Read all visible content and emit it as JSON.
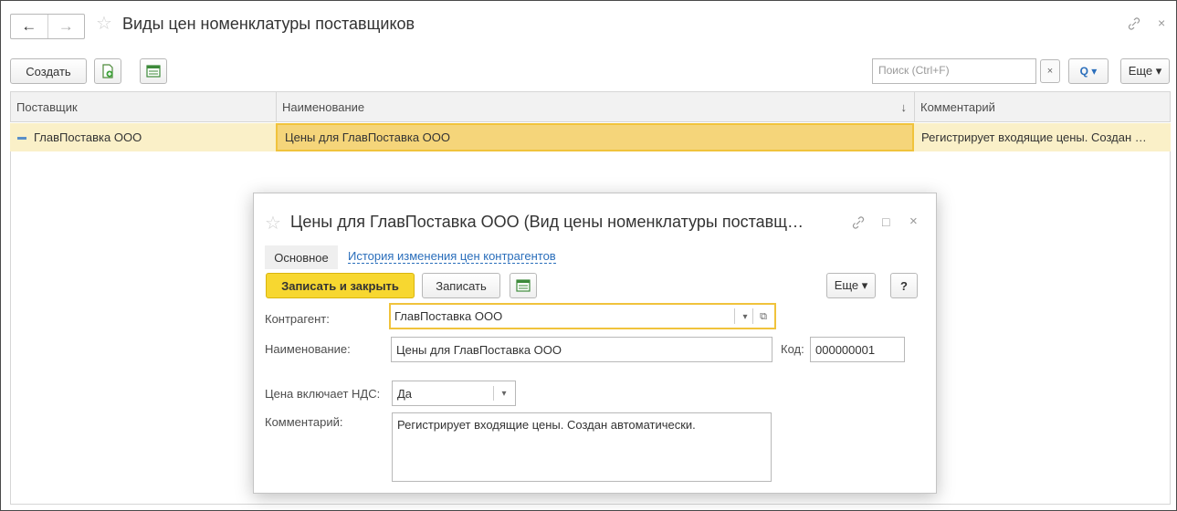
{
  "window": {
    "title": "Виды цен номенклатуры поставщиков",
    "nav_back": "←",
    "nav_forward": "→",
    "star": "☆",
    "link_icon": "🔗",
    "close_icon": "×"
  },
  "toolbar": {
    "create_label": "Создать",
    "search_placeholder": "Поиск (Ctrl+F)",
    "search_clear": "×",
    "search_button": "Q ▾",
    "more_label": "Еще ▾"
  },
  "table": {
    "columns": [
      {
        "label": "Поставщик"
      },
      {
        "label": "Наименование",
        "sort": "↓"
      },
      {
        "label": "Комментарий"
      }
    ],
    "rows": [
      {
        "marker": "▬",
        "supplier": "ГлавПоставка ООО",
        "name": "Цены для ГлавПоставка ООО",
        "comment": "Регистрирует входящие цены. Создан …"
      }
    ]
  },
  "dialog": {
    "star": "☆",
    "title": "Цены для ГлавПоставка ООО (Вид цены номенклатуры поставщ…",
    "link_icon": "🔗",
    "maximize_icon": "□",
    "close_icon": "×",
    "tabs": [
      {
        "label": "Основное"
      },
      {
        "label": "История изменения цен контрагентов"
      }
    ],
    "save_close_label": "Записать и закрыть",
    "save_label": "Записать",
    "more_label": "Еще ▾",
    "help_label": "?",
    "counterparty_label": "Контрагент:",
    "counterparty_value": "ГлавПоставка ООО",
    "dropdown_glyph": "▾",
    "open_glyph": "⧉",
    "name_label": "Наименование:",
    "name_value": "Цены для ГлавПоставка ООО",
    "code_label": "Код:",
    "code_value": "000000001",
    "vat_label": "Цена включает НДС:",
    "vat_value": "Да",
    "comment_label": "Комментарий:",
    "comment_value": "Регистрирует входящие цены. Создан автоматически."
  },
  "colors": {
    "selected_row": "#faf0c8",
    "selected_cell": "#f5d57a",
    "focus_border": "#f0c33c",
    "primary_button": "#f7d730",
    "link": "#2a6ebb"
  }
}
